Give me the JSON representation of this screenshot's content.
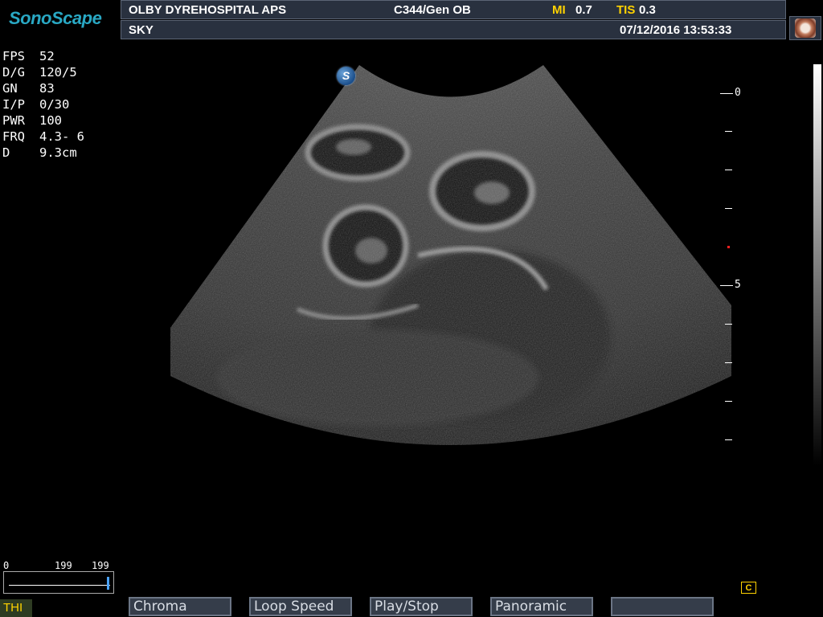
{
  "logo": "SonoScape",
  "header": {
    "hospital": "OLBY DYREHOSPITAL APS",
    "probe_preset": "C344/Gen OB",
    "mi_label": "MI",
    "mi_value": "0.7",
    "tis_label": "TIS",
    "tis_value": "0.3",
    "patient": "SKY",
    "datetime": "07/12/2016 13:53:33"
  },
  "params": [
    {
      "label": "FPS",
      "value": "52"
    },
    {
      "label": "D/G",
      "value": "120/5"
    },
    {
      "label": "GN",
      "value": "83"
    },
    {
      "label": "I/P",
      "value": "0/30"
    },
    {
      "label": "PWR",
      "value": "100"
    },
    {
      "label": "FRQ",
      "value": "4.3- 6"
    },
    {
      "label": "D",
      "value": "9.3cm"
    }
  ],
  "orientation_marker": "S",
  "depth_scale": {
    "labels": [
      "0",
      "5"
    ],
    "unit_max_cm": 9.3
  },
  "cine": {
    "start": "0",
    "current": "199",
    "end": "199"
  },
  "mode_tab": "THI",
  "softkeys": [
    "Chroma",
    "Loop Speed",
    "Play/Stop",
    "Panoramic",
    ""
  ],
  "cine_icon": "C",
  "colors": {
    "header_bg": "#29313f",
    "accent_yellow": "#ffd200",
    "logo": "#29a8c4"
  }
}
